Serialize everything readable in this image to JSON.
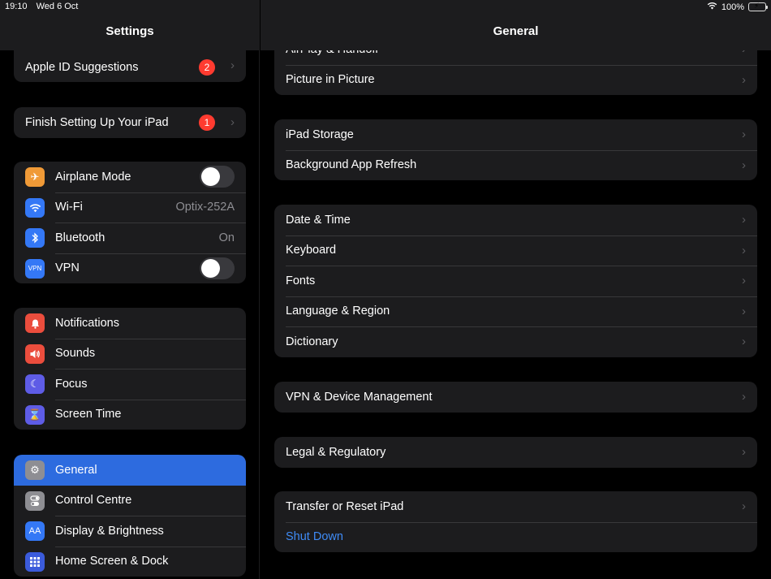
{
  "status": {
    "time": "19:10",
    "date": "Wed 6 Oct",
    "battery": "100%"
  },
  "sidebar": {
    "title": "Settings",
    "apple_id": {
      "label": "Apple ID Suggestions",
      "badge": "2"
    },
    "finish_setup": {
      "label": "Finish Setting Up Your iPad",
      "badge": "1"
    },
    "connectivity": [
      {
        "label": "Airplane Mode",
        "icon": "airplane-icon",
        "color": "#f09a37",
        "toggle": false
      },
      {
        "label": "Wi-Fi",
        "icon": "wifi-icon",
        "color": "#3478f6",
        "value": "Optix-252A"
      },
      {
        "label": "Bluetooth",
        "icon": "bluetooth-icon",
        "color": "#3478f6",
        "value": "On"
      },
      {
        "label": "VPN",
        "icon": "vpn-icon",
        "color": "#3478f6",
        "toggle": false
      }
    ],
    "notifications": [
      {
        "label": "Notifications",
        "icon": "bell-icon",
        "color": "#eb4d3d"
      },
      {
        "label": "Sounds",
        "icon": "speaker-icon",
        "color": "#eb4d3d"
      },
      {
        "label": "Focus",
        "icon": "moon-icon",
        "color": "#5e5ce6"
      },
      {
        "label": "Screen Time",
        "icon": "hourglass-icon",
        "color": "#5e5ce6"
      }
    ],
    "general": [
      {
        "label": "General",
        "icon": "gear-icon",
        "color": "#8e8e93",
        "selected": true
      },
      {
        "label": "Control Centre",
        "icon": "switches-icon",
        "color": "#8e8e93"
      },
      {
        "label": "Display & Brightness",
        "icon": "text-size-icon",
        "color": "#3478f6"
      },
      {
        "label": "Home Screen & Dock",
        "icon": "grid-icon",
        "color": "#3b5bdb"
      }
    ]
  },
  "main": {
    "title": "General",
    "group1": [
      "AirPlay & Handoff",
      "Picture in Picture"
    ],
    "group2": [
      "iPad Storage",
      "Background App Refresh"
    ],
    "group3": [
      "Date & Time",
      "Keyboard",
      "Fonts",
      "Language & Region",
      "Dictionary"
    ],
    "group4": [
      "VPN & Device Management"
    ],
    "group5": [
      "Legal & Regulatory"
    ],
    "group6": {
      "transfer": "Transfer or Reset iPad",
      "shutdown": "Shut Down"
    }
  }
}
